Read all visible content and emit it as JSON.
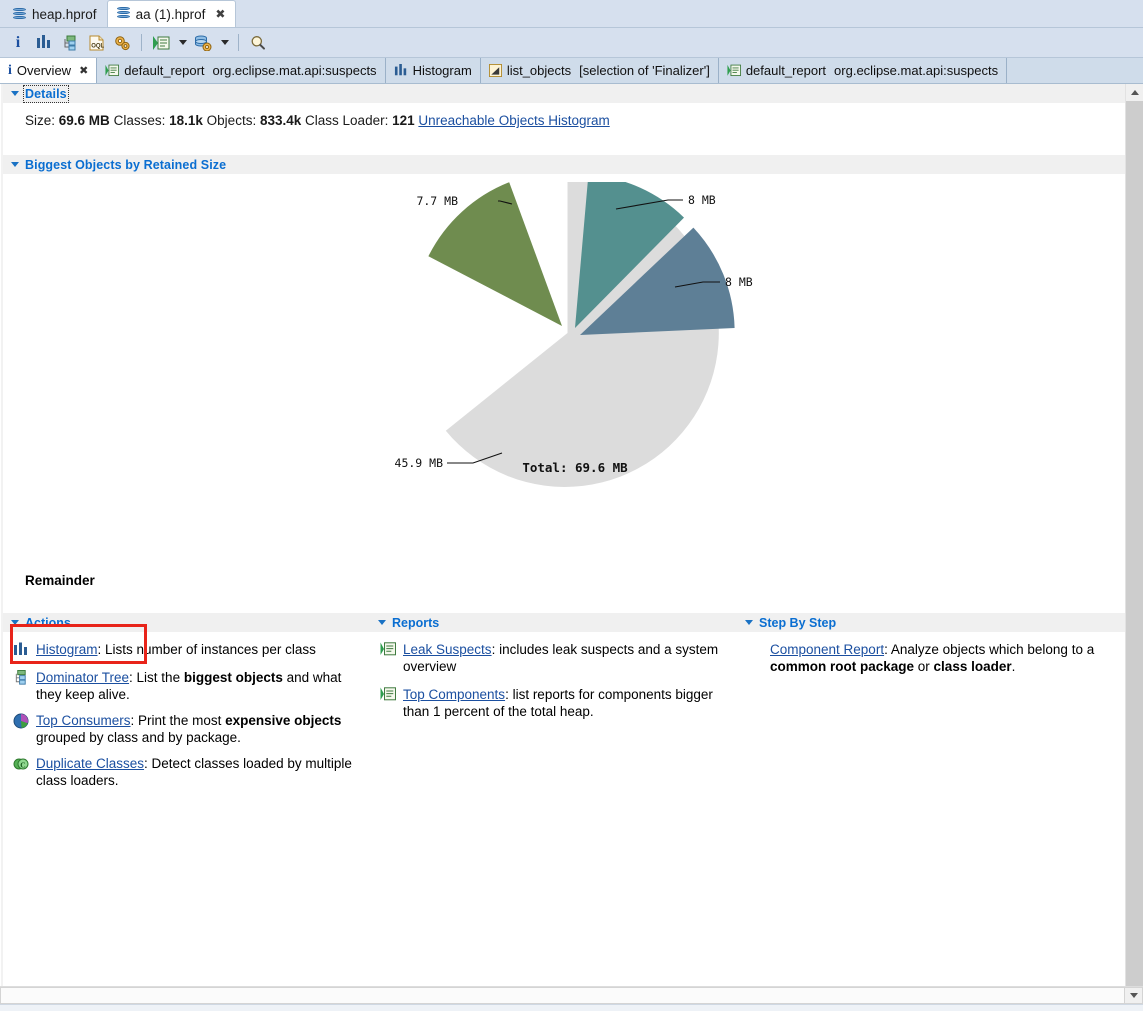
{
  "editor_tabs": [
    {
      "label": "heap.hprof",
      "icon": "database-icon",
      "active": false,
      "closable": false
    },
    {
      "label": "aa (1).hprof",
      "icon": "database-icon",
      "active": true,
      "closable": true
    }
  ],
  "toolbar": {
    "buttons": [
      {
        "name": "heap-dump-overview-button",
        "icon": "info-i-icon",
        "label": "i"
      },
      {
        "name": "histogram-button",
        "icon": "histogram-bars-icon",
        "label": "Histogram"
      },
      {
        "name": "dominator-tree-button",
        "icon": "dominator-tree-icon",
        "label": "Dominator Tree"
      },
      {
        "name": "oql-button",
        "icon": "oql-document-icon",
        "label": "OQL"
      },
      {
        "name": "calculate-retained-size-button",
        "icon": "gears-icon",
        "label": "Calculate"
      },
      {
        "name": "run-report-button",
        "icon": "run-expert-system-icon",
        "label": "Run Expert System Test",
        "has_dropdown": true
      },
      {
        "name": "query-browser-button",
        "icon": "database-gear-icon",
        "label": "Query Browser",
        "has_dropdown": true
      },
      {
        "name": "find-button",
        "icon": "magnifier-icon",
        "label": "Find"
      }
    ]
  },
  "view_tabs": [
    {
      "label": "Overview",
      "icon": "info-i-icon",
      "active": true,
      "closable": true,
      "suffix": ""
    },
    {
      "label": "default_report",
      "suffix": "org.eclipse.mat.api:suspects",
      "icon": "report-icon",
      "active": false,
      "closable": false
    },
    {
      "label": "Histogram",
      "suffix": "",
      "icon": "histogram-bars-icon",
      "active": false,
      "closable": false
    },
    {
      "label": "list_objects",
      "suffix": "[selection of 'Finalizer']",
      "icon": "list-objects-icon",
      "active": false,
      "closable": false
    },
    {
      "label": "default_report",
      "suffix": "org.eclipse.mat.api:suspects",
      "icon": "report-icon",
      "active": false,
      "closable": false
    }
  ],
  "details": {
    "section_title": "Details",
    "size_label": "Size:",
    "size_value": "69.6 MB",
    "classes_label": "Classes:",
    "classes_value": "18.1k",
    "objects_label": "Objects:",
    "objects_value": "833.4k",
    "classloader_label": "Class Loader:",
    "classloader_value": "121",
    "unreachable_link": "Unreachable Objects Histogram"
  },
  "biggest_objects": {
    "section_title": "Biggest Objects by Retained Size",
    "remainder_label": "Remainder"
  },
  "chart_data": {
    "type": "pie",
    "title": "Biggest Objects by Retained Size",
    "total_label": "Total: 69.6 MB",
    "total_value": 69.6,
    "unit": "MB",
    "legend_position": "none",
    "slices": [
      {
        "label": "8 MB",
        "value": 8.0,
        "color": "#5e7f96",
        "exploded": true,
        "label_side": "right"
      },
      {
        "label": "8 MB",
        "value": 8.0,
        "color": "#54908f",
        "exploded": true,
        "label_side": "right"
      },
      {
        "label": "7.7 MB",
        "value": 7.7,
        "color": "#6f8c4f",
        "exploded": true,
        "label_side": "left"
      },
      {
        "label": "45.9 MB",
        "value": 45.9,
        "color": "#dcdcdc",
        "exploded": false,
        "label_side": "left"
      }
    ]
  },
  "actions": {
    "section_title": "Actions",
    "items": [
      {
        "icon": "histogram-bars-icon",
        "link": "Histogram",
        "text_before": "",
        "text": ": Lists number of instances per class",
        "highlighted": true
      },
      {
        "icon": "dominator-tree-icon",
        "link": "Dominator Tree",
        "text": ": List the ",
        "bold1": "biggest objects",
        "text2": " and what they keep alive."
      },
      {
        "icon": "top-consumers-pie-icon",
        "link": "Top Consumers",
        "text": ": Print the most ",
        "bold1": "expensive objects",
        "text2": " grouped by class and by package."
      },
      {
        "icon": "duplicate-classes-icon",
        "link": "Duplicate Classes",
        "text": ": Detect classes loaded by multiple class loaders."
      }
    ]
  },
  "reports": {
    "section_title": "Reports",
    "items": [
      {
        "icon": "report-icon",
        "link": "Leak Suspects",
        "text": ": includes leak suspects and a system overview"
      },
      {
        "icon": "report-icon",
        "link": "Top Components",
        "text": ": list reports for components bigger than 1 percent of the total heap."
      }
    ]
  },
  "step_by_step": {
    "section_title": "Step By Step",
    "items": [
      {
        "link": "Component Report",
        "text": ": Analyze objects which belong to a ",
        "bold1": "common root package",
        "text2": " or ",
        "bold2": "class loader",
        "text3": "."
      }
    ]
  },
  "colors": {
    "link": "#1b4fa0",
    "section_header": "#0a6ed1",
    "annotation": "#e8241a",
    "tab_bar": "#d6e0ee"
  }
}
